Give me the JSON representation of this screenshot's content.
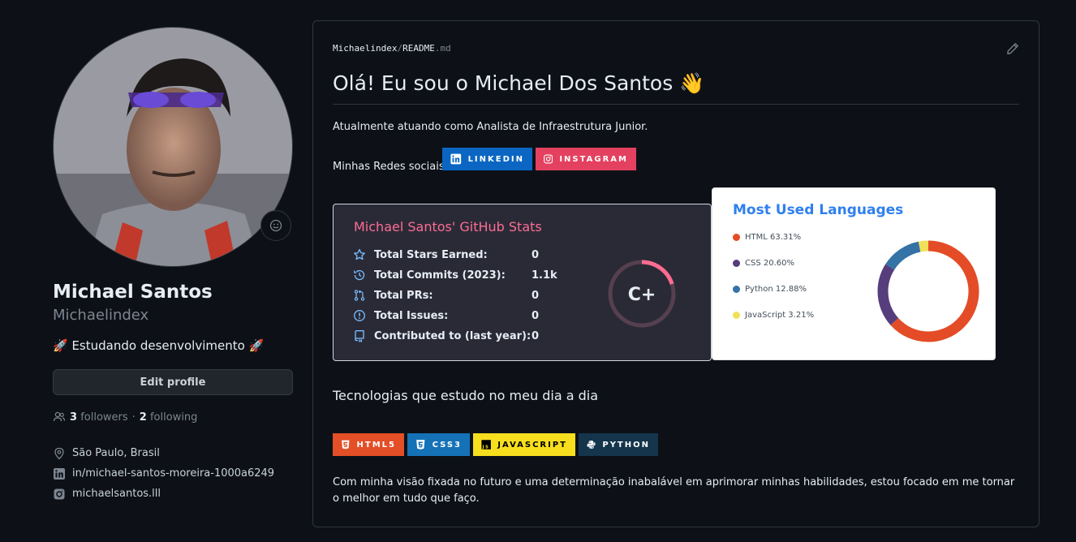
{
  "profile": {
    "name": "Michael Santos",
    "login": "Michaelindex",
    "bio": "🚀 Estudando desenvolvimento 🚀",
    "edit_label": "Edit profile",
    "followers_count": "3",
    "followers_label": "followers",
    "separator": "·",
    "following_count": "2",
    "following_label": "following",
    "location": "São Paulo, Brasil",
    "linkedin": "in/michael-santos-moreira-1000a6249",
    "instagram": "michaelsantos.lll"
  },
  "readme": {
    "crumb_owner": "Michaelindex",
    "crumb_sep": "/",
    "crumb_file": "README",
    "crumb_ext": ".md",
    "title": "Olá! Eu sou o Michael Dos Santos 👋",
    "intro": "Atualmente atuando como Analista de Infraestrutura Junior.",
    "social_label": "Minhas Redes sociais:",
    "badges": [
      {
        "label": "LINKEDIN",
        "color": "#0a66c2",
        "icon": "linkedin-icon"
      },
      {
        "label": "INSTAGRAM",
        "color": "#e4405f",
        "icon": "instagram-icon"
      }
    ],
    "tech_heading": "Tecnologias que estudo no meu dia a dia",
    "tech_badges": [
      {
        "label": "HTML5",
        "color": "#e34f26",
        "icon": "html5-icon"
      },
      {
        "label": "CSS3",
        "color": "#1572b6",
        "icon": "css3-icon"
      },
      {
        "label": "JAVASCRIPT",
        "color": "#f7df1e",
        "icon": "js-icon"
      },
      {
        "label": "PYTHON",
        "color": "#14354c",
        "icon": "python-icon"
      }
    ],
    "closing": "Com minha visão fixada no futuro e uma determinação inabalável em aprimorar minhas habilidades, estou focado em me tornar o melhor em tudo que faço."
  },
  "stats": {
    "title": "Michael Santos' GitHub Stats",
    "rows": [
      {
        "label": "Total Stars Earned:",
        "value": "0",
        "icon": "star-icon"
      },
      {
        "label": "Total Commits (2023):",
        "value": "1.1k",
        "icon": "history-icon"
      },
      {
        "label": "Total PRs:",
        "value": "0",
        "icon": "pull-request-icon"
      },
      {
        "label": "Total Issues:",
        "value": "0",
        "icon": "issue-icon"
      },
      {
        "label": "Contributed to (last year):",
        "value": "0",
        "icon": "repo-icon"
      }
    ],
    "rank": "C+",
    "rank_progress": 0.2,
    "title_color": "#fe6c91",
    "icon_color": "#79ff97"
  },
  "chart_data": {
    "type": "pie",
    "title": "Most Used Languages",
    "categories": [
      "HTML",
      "CSS",
      "Python",
      "JavaScript"
    ],
    "values": [
      63.31,
      20.6,
      12.88,
      3.21
    ],
    "labels": [
      "HTML 63.31%",
      "CSS 20.60%",
      "Python 12.88%",
      "JavaScript 3.21%"
    ],
    "colors": [
      "#e34c26",
      "#563d7c",
      "#3572a5",
      "#f1e05a"
    ],
    "legend": "left"
  }
}
